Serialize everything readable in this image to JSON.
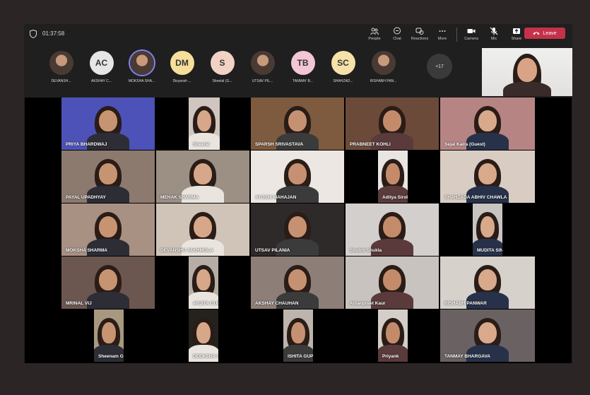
{
  "meeting": {
    "timer": "01:37:58",
    "toolbar": [
      {
        "label": "People",
        "icon": "people-icon"
      },
      {
        "label": "Chat",
        "icon": "chat-icon"
      },
      {
        "label": "Reactions",
        "icon": "reactions-icon"
      },
      {
        "label": "More",
        "icon": "more-icon"
      },
      {
        "label": "Camera",
        "icon": "camera-icon"
      },
      {
        "label": "Mic",
        "icon": "mic-off-icon"
      },
      {
        "label": "Share",
        "icon": "share-icon"
      }
    ],
    "leave_label": "Leave"
  },
  "roster": [
    {
      "initials": "",
      "name": "DEVANSH..."
    },
    {
      "initials": "AC",
      "name": "AKSHAY C..."
    },
    {
      "initials": "",
      "name": "MOKSHA SHA..."
    },
    {
      "initials": "DM",
      "name": "Divyansh ..."
    },
    {
      "initials": "S",
      "name": "Sheetal (G..."
    },
    {
      "initials": "",
      "name": "UTSAV PIL..."
    },
    {
      "initials": "TB",
      "name": "TANMAY B..."
    },
    {
      "initials": "SC",
      "name": "SHAHZAD..."
    },
    {
      "initials": "",
      "name": "RISHABH PAN..."
    }
  ],
  "more_count": "+17",
  "tiles": [
    "PRIYA BHARDWAJ",
    "Sheetal",
    "SPARSH SRIVASTAVA",
    "PRABNEET KOHLI",
    "Sejal Kalra (Guest)",
    "PAYAL UPADHYAY",
    "MEHAK SHARMA",
    "AYUSHI MAHAJAN",
    "Aditya Sirohi",
    "SHAHZADA ABHIV CHAWLA",
    "MOKSHA SHARMA",
    "DEVANSHU JAKHMOLA",
    "UTSAV PILANIA",
    "Shubhi Shukla",
    "MUDITA SINGH",
    "MRINAL VIJ",
    "ARJITA GUPTA",
    "AKSHAY CHAUHAN",
    "Amanpreet Kaur",
    "RISHABH PANWAR",
    "Sheenam Ghai",
    "DEEKSHA SHRIVASTAVA",
    "ISHITA GUPTA",
    "Priyank",
    "TANMAY BHARGAVA"
  ],
  "colors": {
    "leave": "#c4314b",
    "av_AC": "#e6e6e6",
    "av_DM": "#f7df9b",
    "av_S": "#f2d2c4",
    "av_TB": "#f2c6d6",
    "av_SC": "#f6e2a9"
  }
}
